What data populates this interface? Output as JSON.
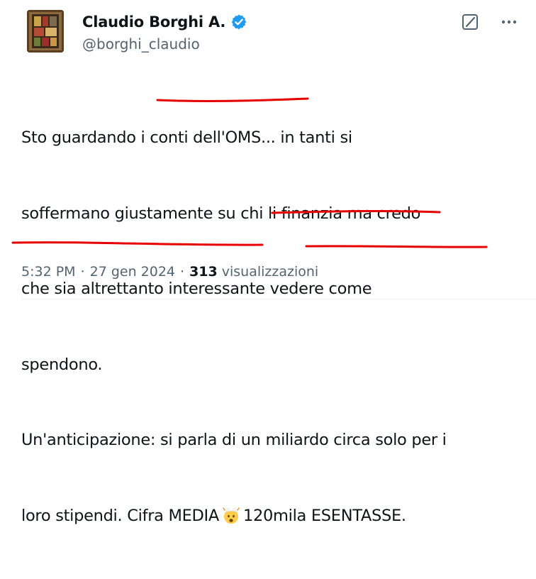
{
  "author": {
    "display_name": "Claudio Borghi A.",
    "handle": "@borghi_claudio",
    "verified": true
  },
  "icons": {
    "verified": "verified-badge-icon",
    "grok": "grok-icon",
    "more": "more-options-icon",
    "emoji": "exploding-head-emoji"
  },
  "colors": {
    "text": "#0f1419",
    "secondary": "#536471",
    "verified_blue": "#1d9bf0",
    "underline_red": "#e60000"
  },
  "tweet": {
    "lines": [
      "Sto guardando i conti dell'OMS... in tanti si",
      "soffermano giustamente su chi li finanzia ma credo",
      "che sia altrettanto interessante vedere come",
      "spendono.",
      "Un'anticipazione: si parla di un miliardo circa solo per i"
    ],
    "last_line_before_emoji": "loro stipendi. Cifra MEDIA",
    "last_line_after_emoji": "120mila ESENTASSE."
  },
  "meta": {
    "time": "5:32 PM",
    "separator": "·",
    "date": "27 gen 2024",
    "views_count": "313",
    "views_label": "visualizzazioni"
  }
}
